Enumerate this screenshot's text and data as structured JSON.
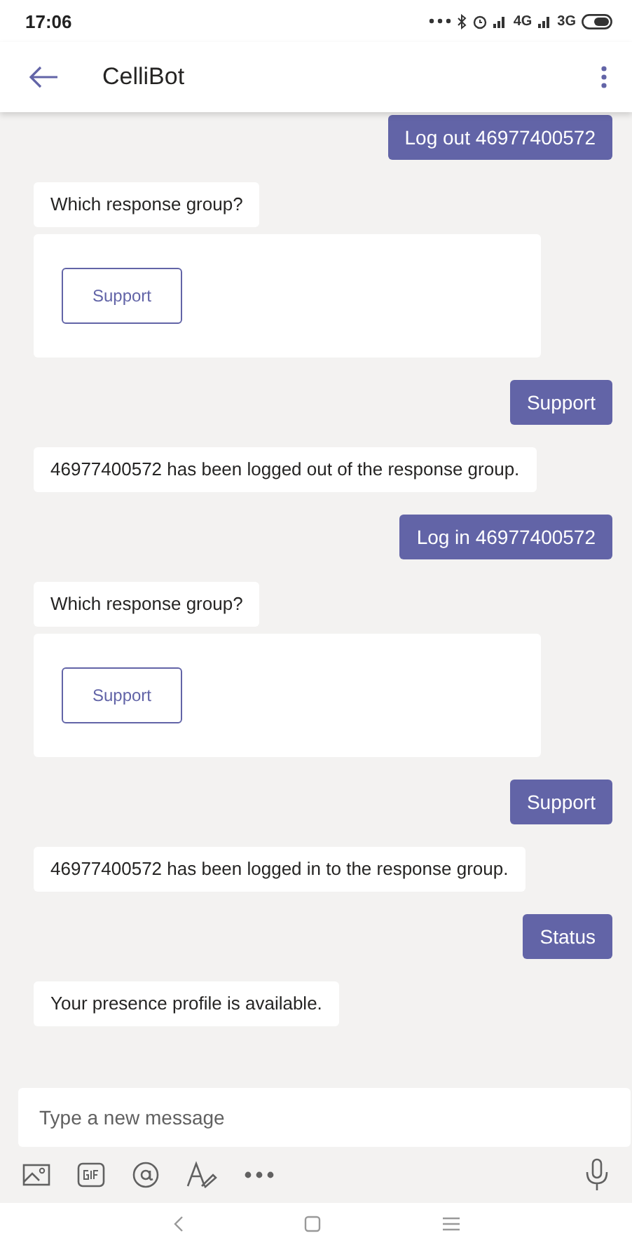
{
  "status_bar": {
    "time": "17:06",
    "networks": [
      "4G",
      "3G"
    ]
  },
  "header": {
    "title": "CelliBot"
  },
  "messages": [
    {
      "kind": "sent",
      "text": "Log out 46977400572"
    },
    {
      "kind": "received",
      "text": "Which response group?"
    },
    {
      "kind": "card",
      "button": "Support"
    },
    {
      "kind": "sent",
      "text": "Support"
    },
    {
      "kind": "received",
      "text": "46977400572 has been logged out of the response group."
    },
    {
      "kind": "sent",
      "text": "Log in 46977400572"
    },
    {
      "kind": "received",
      "text": "Which response group?"
    },
    {
      "kind": "card",
      "button": "Support"
    },
    {
      "kind": "sent",
      "text": "Support"
    },
    {
      "kind": "received",
      "text": "46977400572 has been logged in to the response group."
    },
    {
      "kind": "sent",
      "text": "Status"
    },
    {
      "kind": "received",
      "text": "Your presence profile is available."
    }
  ],
  "composer": {
    "placeholder": "Type a new message"
  }
}
